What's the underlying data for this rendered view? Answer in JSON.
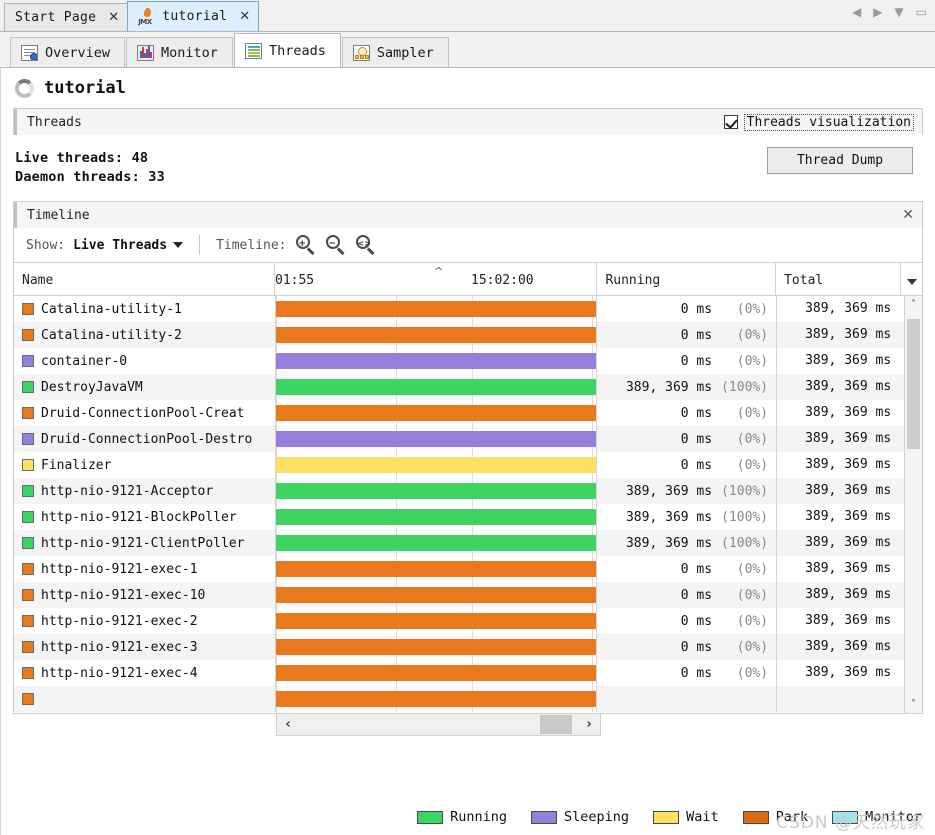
{
  "window": {
    "tabs": [
      {
        "label": "Start Page",
        "icon": "none",
        "active": false,
        "close": "✕"
      },
      {
        "label": "tutorial",
        "icon": "jmx-icon",
        "active": true,
        "close": "✕"
      }
    ],
    "controls": [
      {
        "name": "back-arrow-icon",
        "glyph": "◀"
      },
      {
        "name": "forward-arrow-icon",
        "glyph": "▶"
      },
      {
        "name": "dropdown-icon",
        "glyph": "▼"
      },
      {
        "name": "maximize-icon",
        "glyph": "▭"
      }
    ]
  },
  "view_tabs": [
    {
      "label": "Overview",
      "icon": "overview-icon",
      "active": false
    },
    {
      "label": "Monitor",
      "icon": "monitor-icon",
      "active": false
    },
    {
      "label": "Threads",
      "icon": "threads-icon",
      "active": true
    },
    {
      "label": "Sampler",
      "icon": "sampler-icon",
      "active": false
    }
  ],
  "app_title": "tutorial",
  "threads_panel": {
    "title": "Threads",
    "visualization_checkbox": {
      "label": "Threads visualization",
      "checked": true
    },
    "live_threads_label": "Live threads:",
    "live_threads_value": "48",
    "daemon_threads_label": "Daemon threads:",
    "daemon_threads_value": "33",
    "thread_dump_button": "Thread Dump"
  },
  "timeline_panel": {
    "title": "Timeline",
    "close_glyph": "✕",
    "show_label": "Show:",
    "show_value": "Live Threads",
    "timeline_label": "Timeline:",
    "zoom_in": "+",
    "zoom_out": "−",
    "zoom_fit": "<>"
  },
  "table": {
    "columns": [
      "Name",
      "",
      "Running",
      "Total"
    ],
    "time_ticks": [
      "01:55",
      "15:02:00"
    ],
    "menu_glyph": "▼",
    "rows": [
      {
        "name": "Catalina-utility-1",
        "color": "#E8791C",
        "state": "Park",
        "running": "0 ms",
        "running_pct": "(0%)",
        "total": "389, 369 ms"
      },
      {
        "name": "Catalina-utility-2",
        "color": "#E8791C",
        "state": "Park",
        "running": "0 ms",
        "running_pct": "(0%)",
        "total": "389, 369 ms"
      },
      {
        "name": "container-0",
        "color": "#9280DC",
        "state": "Sleeping",
        "running": "0 ms",
        "running_pct": "(0%)",
        "total": "389, 369 ms"
      },
      {
        "name": "DestroyJavaVM",
        "color": "#3DD464",
        "state": "Running",
        "running": "389, 369 ms",
        "running_pct": "(100%)",
        "total": "389, 369 ms"
      },
      {
        "name": "Druid-ConnectionPool-Creat",
        "color": "#E8791C",
        "state": "Park",
        "running": "0 ms",
        "running_pct": "(0%)",
        "total": "389, 369 ms"
      },
      {
        "name": "Druid-ConnectionPool-Destro",
        "color": "#9280DC",
        "state": "Sleeping",
        "running": "0 ms",
        "running_pct": "(0%)",
        "total": "389, 369 ms"
      },
      {
        "name": "Finalizer",
        "color": "#FCDF63",
        "state": "Wait",
        "running": "0 ms",
        "running_pct": "(0%)",
        "total": "389, 369 ms"
      },
      {
        "name": "http-nio-9121-Acceptor",
        "color": "#3DD464",
        "state": "Running",
        "running": "389, 369 ms",
        "running_pct": "(100%)",
        "total": "389, 369 ms"
      },
      {
        "name": "http-nio-9121-BlockPoller",
        "color": "#3DD464",
        "state": "Running",
        "running": "389, 369 ms",
        "running_pct": "(100%)",
        "total": "389, 369 ms"
      },
      {
        "name": "http-nio-9121-ClientPoller",
        "color": "#3DD464",
        "state": "Running",
        "running": "389, 369 ms",
        "running_pct": "(100%)",
        "total": "389, 369 ms"
      },
      {
        "name": "http-nio-9121-exec-1",
        "color": "#E8791C",
        "state": "Park",
        "running": "0 ms",
        "running_pct": "(0%)",
        "total": "389, 369 ms"
      },
      {
        "name": "http-nio-9121-exec-10",
        "color": "#E8791C",
        "state": "Park",
        "running": "0 ms",
        "running_pct": "(0%)",
        "total": "389, 369 ms"
      },
      {
        "name": "http-nio-9121-exec-2",
        "color": "#E8791C",
        "state": "Park",
        "running": "0 ms",
        "running_pct": "(0%)",
        "total": "389, 369 ms"
      },
      {
        "name": "http-nio-9121-exec-3",
        "color": "#E8791C",
        "state": "Park",
        "running": "0 ms",
        "running_pct": "(0%)",
        "total": "389, 369 ms"
      },
      {
        "name": "http-nio-9121-exec-4",
        "color": "#E8791C",
        "state": "Park",
        "running": "0 ms",
        "running_pct": "(0%)",
        "total": "389, 369 ms"
      },
      {
        "name": "",
        "color": "#E8791C",
        "state": "Park",
        "running": "",
        "running_pct": "",
        "total": ""
      }
    ]
  },
  "scroll": {
    "up_glyph": "˄",
    "down_glyph": "˅",
    "left_glyph": "‹",
    "right_glyph": "›"
  },
  "legend": [
    {
      "label": "Running",
      "color": "#3DD464"
    },
    {
      "label": "Sleeping",
      "color": "#9280DC"
    },
    {
      "label": "Wait",
      "color": "#FCDF63"
    },
    {
      "label": "Park",
      "color": "#DD6B12"
    },
    {
      "label": "Monitor",
      "color": "#9FE6EC"
    }
  ],
  "watermark": "CSDN @天然玩家"
}
